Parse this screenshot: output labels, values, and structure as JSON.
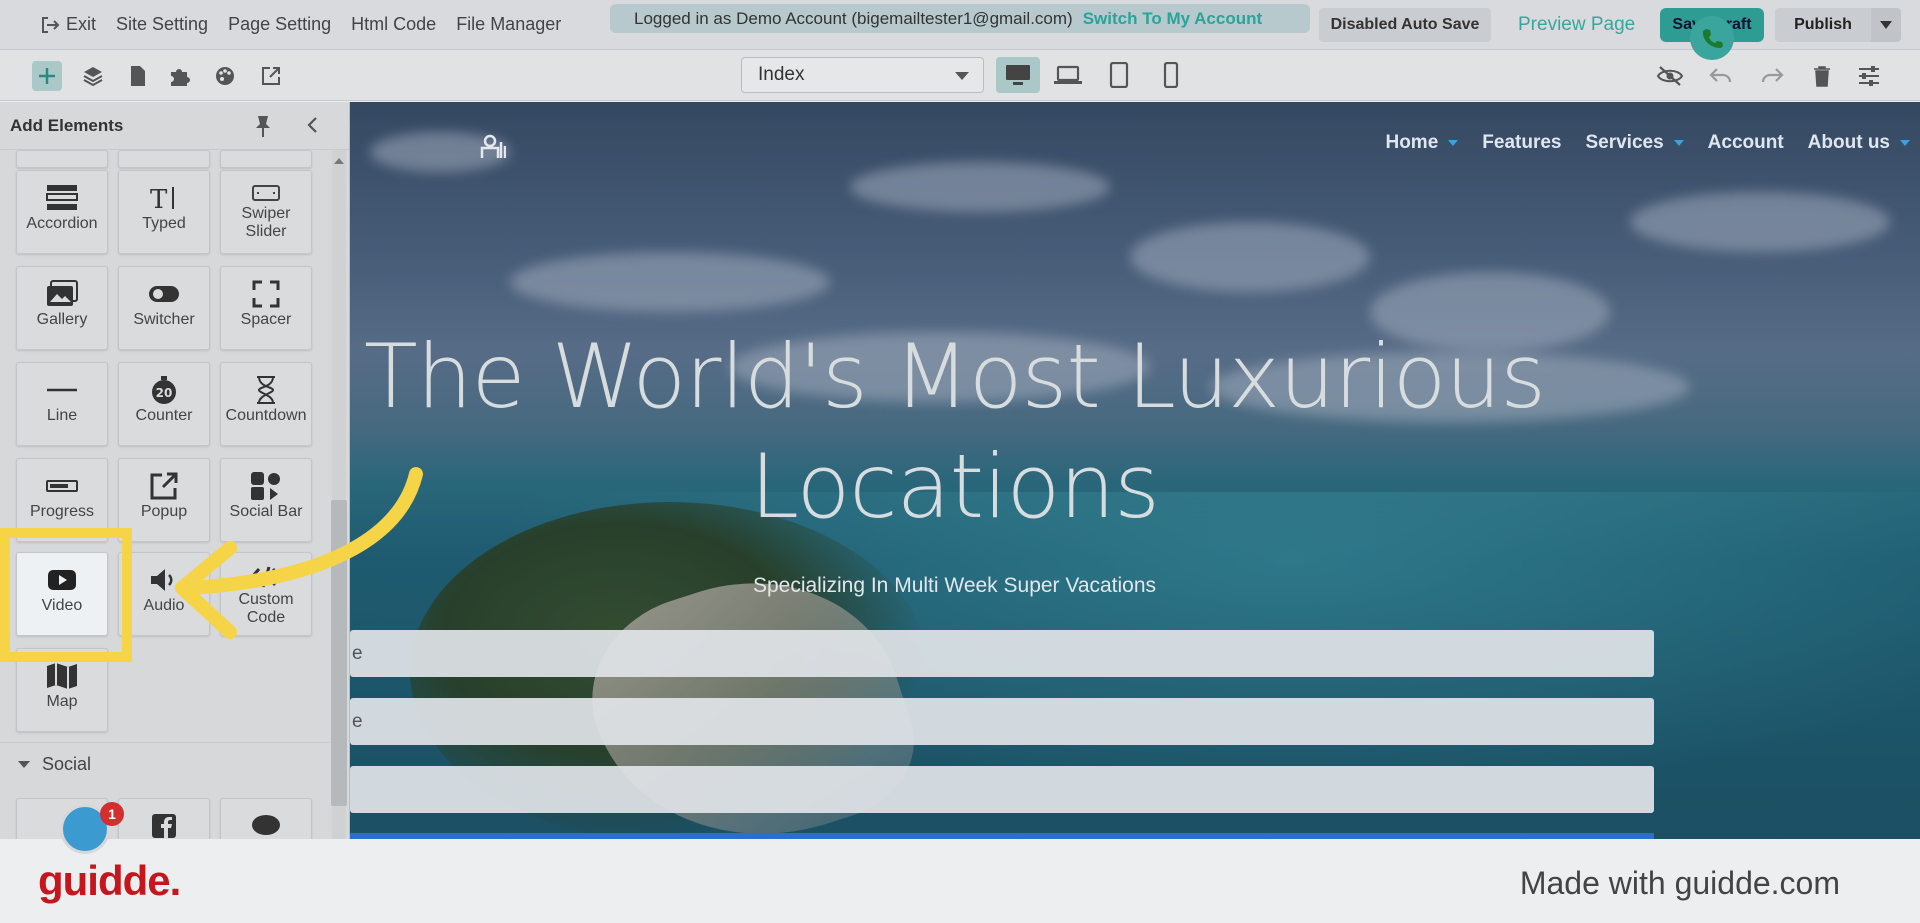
{
  "topbar": {
    "exit_label": "Exit",
    "site_setting": "Site Setting",
    "page_setting": "Page Setting",
    "html_code": "Html Code",
    "file_manager": "File Manager",
    "login_text": "Logged in as Demo Account (bigemailtester1@gmail.com)",
    "switch_label": "Switch To My Account",
    "auto_save": "Disabled Auto Save",
    "preview": "Preview Page",
    "save_draft": "Save Draft",
    "publish": "Publish"
  },
  "toolbar": {
    "page_select": "Index"
  },
  "panel": {
    "title": "Add Elements",
    "tiles": {
      "accordion": "Accordion",
      "typed": "Typed",
      "swiper": "Swiper\nSlider",
      "gallery": "Gallery",
      "switcher": "Switcher",
      "spacer": "Spacer",
      "line": "Line",
      "counter": "Counter",
      "countdown": "Countdown",
      "progress": "Progress",
      "popup": "Popup",
      "social_bar": "Social Bar",
      "video": "Video",
      "audio": "Audio",
      "custom_code": "Custom\nCode",
      "map": "Map"
    },
    "section_social": "Social",
    "badge_count": "1"
  },
  "canvas": {
    "nav": {
      "home": "Home",
      "features": "Features",
      "services": "Services",
      "account": "Account",
      "about": "About us"
    },
    "hero_title": "The World's Most Luxurious Locations",
    "hero_subtitle": "Specializing In Multi Week Super Vacations",
    "field1": "e",
    "field2": "e",
    "field3": ""
  },
  "footer": {
    "brand": "guidde.",
    "made_with": "Made with guidde.com"
  },
  "colors": {
    "accent": "#3aa59c",
    "highlight": "#f5d547",
    "brand_red": "#c4161c"
  }
}
